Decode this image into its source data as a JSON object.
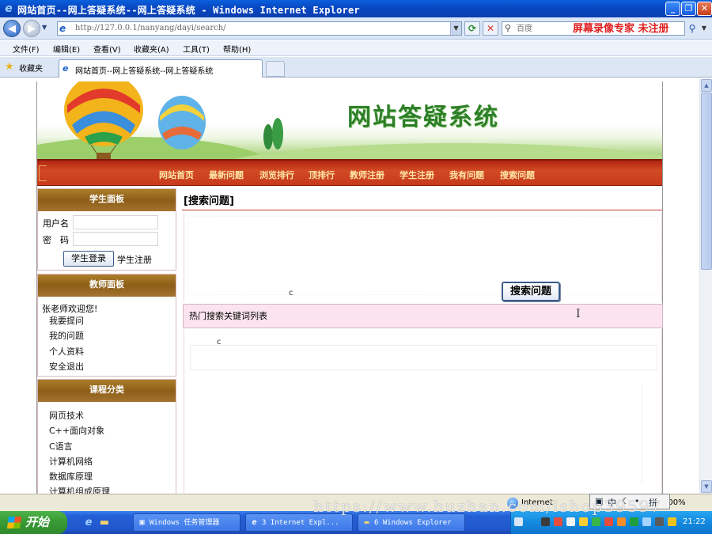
{
  "window": {
    "title": "网站首页--网上答疑系统--网上答疑系统 - Windows Internet Explorer"
  },
  "addressbar": {
    "url": "http://127.0.0.1/nanyang/dayi/search/",
    "search_placeholder": "百度",
    "recorder_watermark": "屏幕录像专家 未注册"
  },
  "menu": {
    "items": [
      "文件(F)",
      "编辑(E)",
      "查看(V)",
      "收藏夹(A)",
      "工具(T)",
      "帮助(H)"
    ]
  },
  "favorites": {
    "label": "收藏夹",
    "tab_title": "网站首页--网上答疑系统--网上答疑系统"
  },
  "site": {
    "banner_title": "网站答疑系统",
    "nav": [
      "网站首页",
      "最新问题",
      "浏览排行",
      "顶排行",
      "教师注册",
      "学生注册",
      "我有问题",
      "搜索问题"
    ]
  },
  "sidebar": {
    "student_panel": {
      "title": "学生面板",
      "username_label": "用户名",
      "password_label": "密　码",
      "login_button": "学生登录",
      "register_link": "学生注册"
    },
    "teacher_panel": {
      "title": "教师面板",
      "welcome": "张老师欢迎您!",
      "links": [
        "我要提问",
        "我的问题",
        "个人资料",
        "安全退出"
      ]
    },
    "course_panel": {
      "title": "课程分类",
      "links": [
        "网页技术",
        "C++面向对象",
        "C语言",
        "计算机网络",
        "数据库原理",
        "计算机组成原理"
      ]
    }
  },
  "main": {
    "section_title": "[搜索问题]",
    "stray_char_1": "c",
    "search_button": "搜索问题",
    "hot_keywords_title": "热门搜索关键词列表",
    "stray_char_2": "c"
  },
  "statusbar": {
    "zone": "Internet",
    "zoom": "100%",
    "ime": [
      "中",
      "拼"
    ]
  },
  "taskbar": {
    "start_label": "开始",
    "buttons": [
      "Windows 任务管理器",
      "3 Internet Expl...",
      "6 Windows Explorer"
    ],
    "clock": "21:22"
  },
  "overlay": {
    "watermark": "https://www.huzhan.com/ishop39597"
  },
  "colors": {
    "nav_red": "#c73a1c",
    "nav_text": "#ffe7a8",
    "panel_brown": "#9b6a22",
    "banner_green": "#2d7f27",
    "hot_bar_pink": "#fbe4ee",
    "title_blue": "#0847c1"
  }
}
